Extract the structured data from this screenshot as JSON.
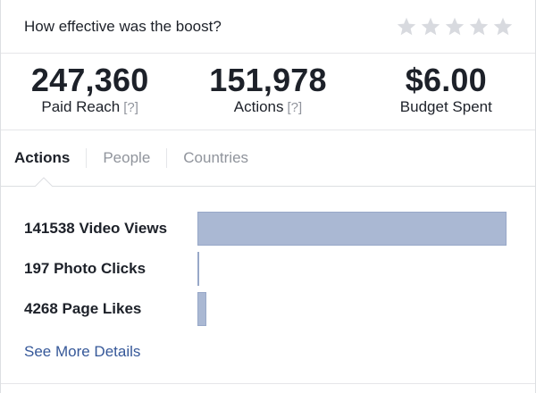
{
  "header": {
    "question": "How effective was the boost?",
    "rating_stars": 5,
    "star_color": "#d8dadf"
  },
  "metrics": [
    {
      "value": "247,360",
      "label": "Paid Reach",
      "help": "[?]"
    },
    {
      "value": "151,978",
      "label": "Actions",
      "help": "[?]"
    },
    {
      "value": "$6.00",
      "label": "Budget Spent",
      "help": ""
    }
  ],
  "tabs": [
    {
      "label": "Actions",
      "active": true
    },
    {
      "label": "People",
      "active": false
    },
    {
      "label": "Countries",
      "active": false
    }
  ],
  "chart_data": {
    "type": "bar",
    "orientation": "horizontal",
    "categories": [
      "141538 Video Views",
      "197 Photo Clicks",
      "4268 Page Likes"
    ],
    "values": [
      141538,
      197,
      4268
    ],
    "bar_color": "#aab8d3"
  },
  "more_link": "See More Details"
}
